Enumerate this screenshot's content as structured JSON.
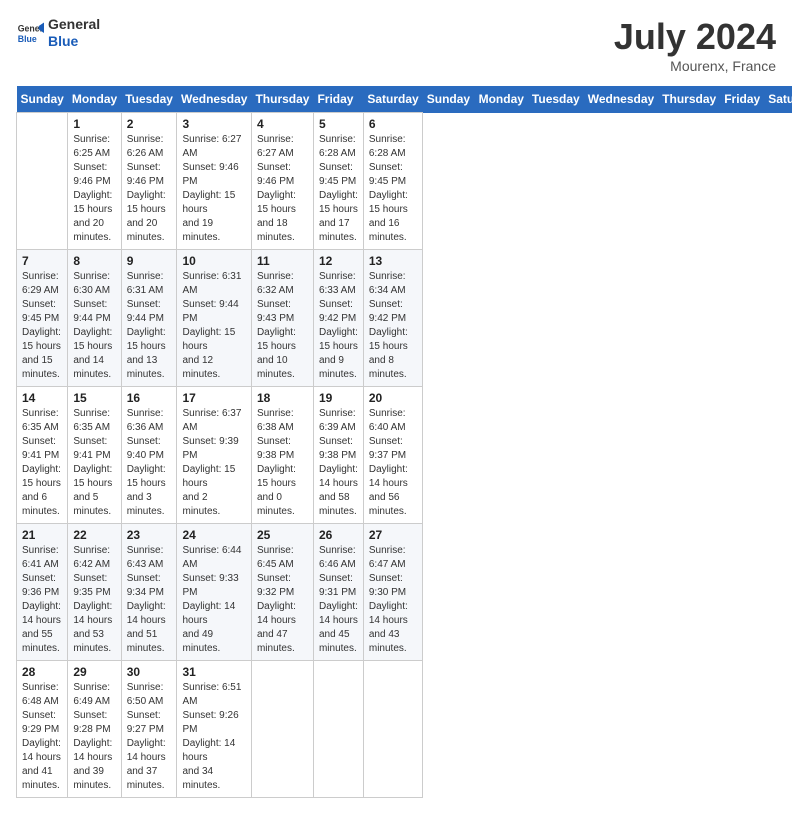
{
  "header": {
    "logo_general": "General",
    "logo_blue": "Blue",
    "month_title": "July 2024",
    "location": "Mourenx, France"
  },
  "days_of_week": [
    "Sunday",
    "Monday",
    "Tuesday",
    "Wednesday",
    "Thursday",
    "Friday",
    "Saturday"
  ],
  "weeks": [
    [
      {
        "day": "",
        "info": ""
      },
      {
        "day": "1",
        "info": "Sunrise: 6:25 AM\nSunset: 9:46 PM\nDaylight: 15 hours\nand 20 minutes."
      },
      {
        "day": "2",
        "info": "Sunrise: 6:26 AM\nSunset: 9:46 PM\nDaylight: 15 hours\nand 20 minutes."
      },
      {
        "day": "3",
        "info": "Sunrise: 6:27 AM\nSunset: 9:46 PM\nDaylight: 15 hours\nand 19 minutes."
      },
      {
        "day": "4",
        "info": "Sunrise: 6:27 AM\nSunset: 9:46 PM\nDaylight: 15 hours\nand 18 minutes."
      },
      {
        "day": "5",
        "info": "Sunrise: 6:28 AM\nSunset: 9:45 PM\nDaylight: 15 hours\nand 17 minutes."
      },
      {
        "day": "6",
        "info": "Sunrise: 6:28 AM\nSunset: 9:45 PM\nDaylight: 15 hours\nand 16 minutes."
      }
    ],
    [
      {
        "day": "7",
        "info": "Sunrise: 6:29 AM\nSunset: 9:45 PM\nDaylight: 15 hours\nand 15 minutes."
      },
      {
        "day": "8",
        "info": "Sunrise: 6:30 AM\nSunset: 9:44 PM\nDaylight: 15 hours\nand 14 minutes."
      },
      {
        "day": "9",
        "info": "Sunrise: 6:31 AM\nSunset: 9:44 PM\nDaylight: 15 hours\nand 13 minutes."
      },
      {
        "day": "10",
        "info": "Sunrise: 6:31 AM\nSunset: 9:44 PM\nDaylight: 15 hours\nand 12 minutes."
      },
      {
        "day": "11",
        "info": "Sunrise: 6:32 AM\nSunset: 9:43 PM\nDaylight: 15 hours\nand 10 minutes."
      },
      {
        "day": "12",
        "info": "Sunrise: 6:33 AM\nSunset: 9:42 PM\nDaylight: 15 hours\nand 9 minutes."
      },
      {
        "day": "13",
        "info": "Sunrise: 6:34 AM\nSunset: 9:42 PM\nDaylight: 15 hours\nand 8 minutes."
      }
    ],
    [
      {
        "day": "14",
        "info": "Sunrise: 6:35 AM\nSunset: 9:41 PM\nDaylight: 15 hours\nand 6 minutes."
      },
      {
        "day": "15",
        "info": "Sunrise: 6:35 AM\nSunset: 9:41 PM\nDaylight: 15 hours\nand 5 minutes."
      },
      {
        "day": "16",
        "info": "Sunrise: 6:36 AM\nSunset: 9:40 PM\nDaylight: 15 hours\nand 3 minutes."
      },
      {
        "day": "17",
        "info": "Sunrise: 6:37 AM\nSunset: 9:39 PM\nDaylight: 15 hours\nand 2 minutes."
      },
      {
        "day": "18",
        "info": "Sunrise: 6:38 AM\nSunset: 9:38 PM\nDaylight: 15 hours\nand 0 minutes."
      },
      {
        "day": "19",
        "info": "Sunrise: 6:39 AM\nSunset: 9:38 PM\nDaylight: 14 hours\nand 58 minutes."
      },
      {
        "day": "20",
        "info": "Sunrise: 6:40 AM\nSunset: 9:37 PM\nDaylight: 14 hours\nand 56 minutes."
      }
    ],
    [
      {
        "day": "21",
        "info": "Sunrise: 6:41 AM\nSunset: 9:36 PM\nDaylight: 14 hours\nand 55 minutes."
      },
      {
        "day": "22",
        "info": "Sunrise: 6:42 AM\nSunset: 9:35 PM\nDaylight: 14 hours\nand 53 minutes."
      },
      {
        "day": "23",
        "info": "Sunrise: 6:43 AM\nSunset: 9:34 PM\nDaylight: 14 hours\nand 51 minutes."
      },
      {
        "day": "24",
        "info": "Sunrise: 6:44 AM\nSunset: 9:33 PM\nDaylight: 14 hours\nand 49 minutes."
      },
      {
        "day": "25",
        "info": "Sunrise: 6:45 AM\nSunset: 9:32 PM\nDaylight: 14 hours\nand 47 minutes."
      },
      {
        "day": "26",
        "info": "Sunrise: 6:46 AM\nSunset: 9:31 PM\nDaylight: 14 hours\nand 45 minutes."
      },
      {
        "day": "27",
        "info": "Sunrise: 6:47 AM\nSunset: 9:30 PM\nDaylight: 14 hours\nand 43 minutes."
      }
    ],
    [
      {
        "day": "28",
        "info": "Sunrise: 6:48 AM\nSunset: 9:29 PM\nDaylight: 14 hours\nand 41 minutes."
      },
      {
        "day": "29",
        "info": "Sunrise: 6:49 AM\nSunset: 9:28 PM\nDaylight: 14 hours\nand 39 minutes."
      },
      {
        "day": "30",
        "info": "Sunrise: 6:50 AM\nSunset: 9:27 PM\nDaylight: 14 hours\nand 37 minutes."
      },
      {
        "day": "31",
        "info": "Sunrise: 6:51 AM\nSunset: 9:26 PM\nDaylight: 14 hours\nand 34 minutes."
      },
      {
        "day": "",
        "info": ""
      },
      {
        "day": "",
        "info": ""
      },
      {
        "day": "",
        "info": ""
      }
    ]
  ]
}
